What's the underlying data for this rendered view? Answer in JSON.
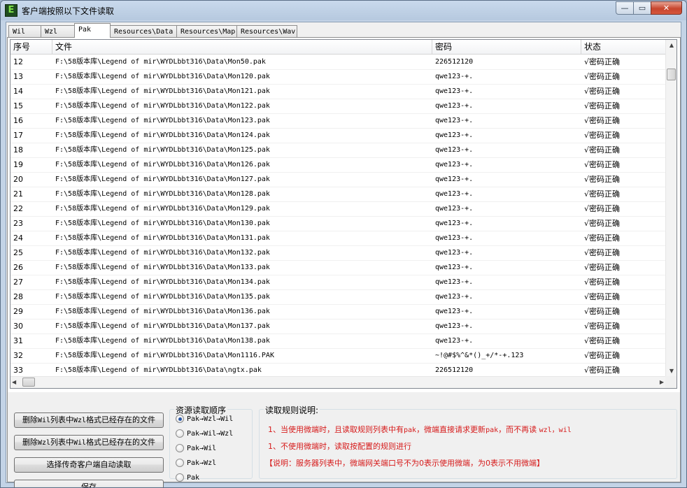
{
  "window": {
    "title": "客户端按照以下文件读取",
    "icon_letter": "E",
    "min_glyph": "—",
    "max_glyph": "▭",
    "close_glyph": "✕"
  },
  "tabs": [
    {
      "label": "Wil",
      "active": false
    },
    {
      "label": "Wzl",
      "active": false
    },
    {
      "label": "Pak",
      "active": true
    },
    {
      "label": "Resources\\Data",
      "active": false
    },
    {
      "label": "Resources\\Map",
      "active": false
    },
    {
      "label": "Resources\\Wav",
      "active": false
    }
  ],
  "table": {
    "columns": [
      "序号",
      "文件",
      "密码",
      "状态"
    ],
    "rows": [
      {
        "no": "12",
        "file": "F:\\58版本库\\Legend of mir\\WYDLbbt316\\Data\\Mon50.pak",
        "pwd": "226512120",
        "status": "√密码正确"
      },
      {
        "no": "13",
        "file": "F:\\58版本库\\Legend of mir\\WYDLbbt316\\Data\\Mon120.pak",
        "pwd": "qwe123-+.",
        "status": "√密码正确"
      },
      {
        "no": "14",
        "file": "F:\\58版本库\\Legend of mir\\WYDLbbt316\\Data\\Mon121.pak",
        "pwd": "qwe123-+.",
        "status": "√密码正确"
      },
      {
        "no": "15",
        "file": "F:\\58版本库\\Legend of mir\\WYDLbbt316\\Data\\Mon122.pak",
        "pwd": "qwe123-+.",
        "status": "√密码正确"
      },
      {
        "no": "16",
        "file": "F:\\58版本库\\Legend of mir\\WYDLbbt316\\Data\\Mon123.pak",
        "pwd": "qwe123-+.",
        "status": "√密码正确"
      },
      {
        "no": "17",
        "file": "F:\\58版本库\\Legend of mir\\WYDLbbt316\\Data\\Mon124.pak",
        "pwd": "qwe123-+.",
        "status": "√密码正确"
      },
      {
        "no": "18",
        "file": "F:\\58版本库\\Legend of mir\\WYDLbbt316\\Data\\Mon125.pak",
        "pwd": "qwe123-+.",
        "status": "√密码正确"
      },
      {
        "no": "19",
        "file": "F:\\58版本库\\Legend of mir\\WYDLbbt316\\Data\\Mon126.pak",
        "pwd": "qwe123-+.",
        "status": "√密码正确"
      },
      {
        "no": "20",
        "file": "F:\\58版本库\\Legend of mir\\WYDLbbt316\\Data\\Mon127.pak",
        "pwd": "qwe123-+.",
        "status": "√密码正确"
      },
      {
        "no": "21",
        "file": "F:\\58版本库\\Legend of mir\\WYDLbbt316\\Data\\Mon128.pak",
        "pwd": "qwe123-+.",
        "status": "√密码正确"
      },
      {
        "no": "22",
        "file": "F:\\58版本库\\Legend of mir\\WYDLbbt316\\Data\\Mon129.pak",
        "pwd": "qwe123-+.",
        "status": "√密码正确"
      },
      {
        "no": "23",
        "file": "F:\\58版本库\\Legend of mir\\WYDLbbt316\\Data\\Mon130.pak",
        "pwd": "qwe123-+.",
        "status": "√密码正确"
      },
      {
        "no": "24",
        "file": "F:\\58版本库\\Legend of mir\\WYDLbbt316\\Data\\Mon131.pak",
        "pwd": "qwe123-+.",
        "status": "√密码正确"
      },
      {
        "no": "25",
        "file": "F:\\58版本库\\Legend of mir\\WYDLbbt316\\Data\\Mon132.pak",
        "pwd": "qwe123-+.",
        "status": "√密码正确"
      },
      {
        "no": "26",
        "file": "F:\\58版本库\\Legend of mir\\WYDLbbt316\\Data\\Mon133.pak",
        "pwd": "qwe123-+.",
        "status": "√密码正确"
      },
      {
        "no": "27",
        "file": "F:\\58版本库\\Legend of mir\\WYDLbbt316\\Data\\Mon134.pak",
        "pwd": "qwe123-+.",
        "status": "√密码正确"
      },
      {
        "no": "28",
        "file": "F:\\58版本库\\Legend of mir\\WYDLbbt316\\Data\\Mon135.pak",
        "pwd": "qwe123-+.",
        "status": "√密码正确"
      },
      {
        "no": "29",
        "file": "F:\\58版本库\\Legend of mir\\WYDLbbt316\\Data\\Mon136.pak",
        "pwd": "qwe123-+.",
        "status": "√密码正确"
      },
      {
        "no": "30",
        "file": "F:\\58版本库\\Legend of mir\\WYDLbbt316\\Data\\Mon137.pak",
        "pwd": "qwe123-+.",
        "status": "√密码正确"
      },
      {
        "no": "31",
        "file": "F:\\58版本库\\Legend of mir\\WYDLbbt316\\Data\\Mon138.pak",
        "pwd": "qwe123-+.",
        "status": "√密码正确"
      },
      {
        "no": "32",
        "file": "F:\\58版本库\\Legend of mir\\WYDLbbt316\\Data\\Mon1116.PAK",
        "pwd": "~!@#$%^&*()_+/*-+.123",
        "status": "√密码正确"
      },
      {
        "no": "33",
        "file": "F:\\58版本库\\Legend of mir\\WYDLbbt316\\Data\\ngtx.pak",
        "pwd": "226512120",
        "status": "√密码正确"
      }
    ]
  },
  "scroll": {
    "up": "▲",
    "down": "▼",
    "left": "◀",
    "right": "▶"
  },
  "buttons": {
    "delete_wil_pre": "删除",
    "delete_wil_mono": "Wil",
    "delete_wil_mid": "列表中",
    "delete_wil_mono2": "Wzl",
    "delete_wil_post": "格式已经存在的文件",
    "delete_wzl_pre": "删除",
    "delete_wzl_mono": "Wzl",
    "delete_wzl_mid": "列表中",
    "delete_wzl_mono2": "Wil",
    "delete_wzl_post": "格式已经存在的文件",
    "auto_read": "选择传奇客户端自动读取",
    "save": "保存"
  },
  "read_order": {
    "title": "资源读取顺序",
    "options": [
      {
        "label": "Pak→Wzl→Wil",
        "checked": true
      },
      {
        "label": "Pak→Wil→Wzl",
        "checked": false
      },
      {
        "label": "Pak→Wil",
        "checked": false
      },
      {
        "label": "Pak→Wzl",
        "checked": false
      },
      {
        "label": "Pak",
        "checked": false
      }
    ]
  },
  "rules": {
    "title": "读取规则说明:",
    "line1_a": "1、当使用微端时，且读取规则列表中有",
    "line1_b": "pak",
    "line1_c": "，微端直接请求更新",
    "line1_d": "pak",
    "line1_e": "，而不再读 ",
    "line1_f": "wzl，wil",
    "line2": "1、不使用微端时，读取按配置的规则进行",
    "line3": "【说明：服务器列表中，微端网关端口号不为0表示使用微端，为0表示不用微端】"
  },
  "colors": {
    "rule_text": "#d61a1a",
    "radio_dot": "#2a57a6",
    "close_btn": "#c7452d"
  }
}
